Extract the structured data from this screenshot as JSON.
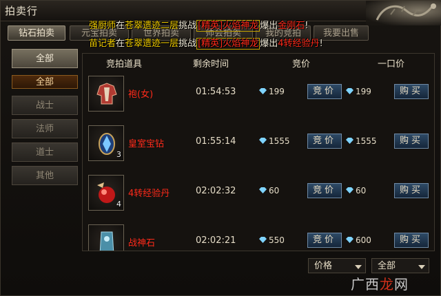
{
  "window": {
    "title": "拍卖行"
  },
  "tabs": [
    {
      "label": "钻石拍卖",
      "active": true
    },
    {
      "label": "元宝拍卖",
      "active": false
    },
    {
      "label": "世界拍卖",
      "active": false
    },
    {
      "label": "师会拍卖",
      "active": false
    },
    {
      "label": "我的竞拍",
      "active": false
    },
    {
      "label": "我要出售",
      "active": false
    }
  ],
  "announcements": [
    {
      "player": "强厨师",
      "t1": "在",
      "place": "苍翠遗迹二层",
      "t2": "挑战",
      "boss": "[精英]火焰神龙",
      "t3": "爆出",
      "loot": "金刚石",
      "end": "!"
    },
    {
      "player": "苗记者",
      "t1": "在",
      "place": "苍翠遗迹一层",
      "t2": "挑战",
      "boss": "[精英]火焰神龙",
      "t3": "爆出",
      "loot": "4转经验丹",
      "end": "!"
    }
  ],
  "sidebar": {
    "header": "全部",
    "items": [
      "全部",
      "战士",
      "法师",
      "道士",
      "其他"
    ]
  },
  "table": {
    "headers": {
      "item": "竞拍道具",
      "time": "剩余时间",
      "bid": "竞价",
      "buyout": "一口价"
    },
    "rows": [
      {
        "name": "袍(女)",
        "qty": "",
        "time": "01:54:53",
        "bid": "199",
        "buyout": "199",
        "bid_btn": "竞价",
        "buy_btn": "购买",
        "icon": "robe-icon"
      },
      {
        "name": "皇室宝钻",
        "qty": "3",
        "time": "01:55:14",
        "bid": "1555",
        "buyout": "1555",
        "bid_btn": "竞价",
        "buy_btn": "购买",
        "icon": "blue-gem-icon"
      },
      {
        "name": "4转经验丹",
        "qty": "4",
        "time": "02:02:32",
        "bid": "60",
        "buyout": "60",
        "bid_btn": "竞价",
        "buy_btn": "购买",
        "icon": "red-pill-icon"
      },
      {
        "name": "战神石",
        "qty": "",
        "time": "02:02:21",
        "bid": "550",
        "buyout": "600",
        "bid_btn": "竞价",
        "buy_btn": "购买",
        "icon": "war-stone-icon"
      }
    ]
  },
  "filters": {
    "sort": "价格",
    "category": "全部"
  },
  "watermark": {
    "part1": "广西",
    "part2": "龙",
    "part3": "网"
  },
  "colors": {
    "item_name": "#ff2a1a",
    "player": "#f5d000",
    "button": "#2e4a66"
  }
}
